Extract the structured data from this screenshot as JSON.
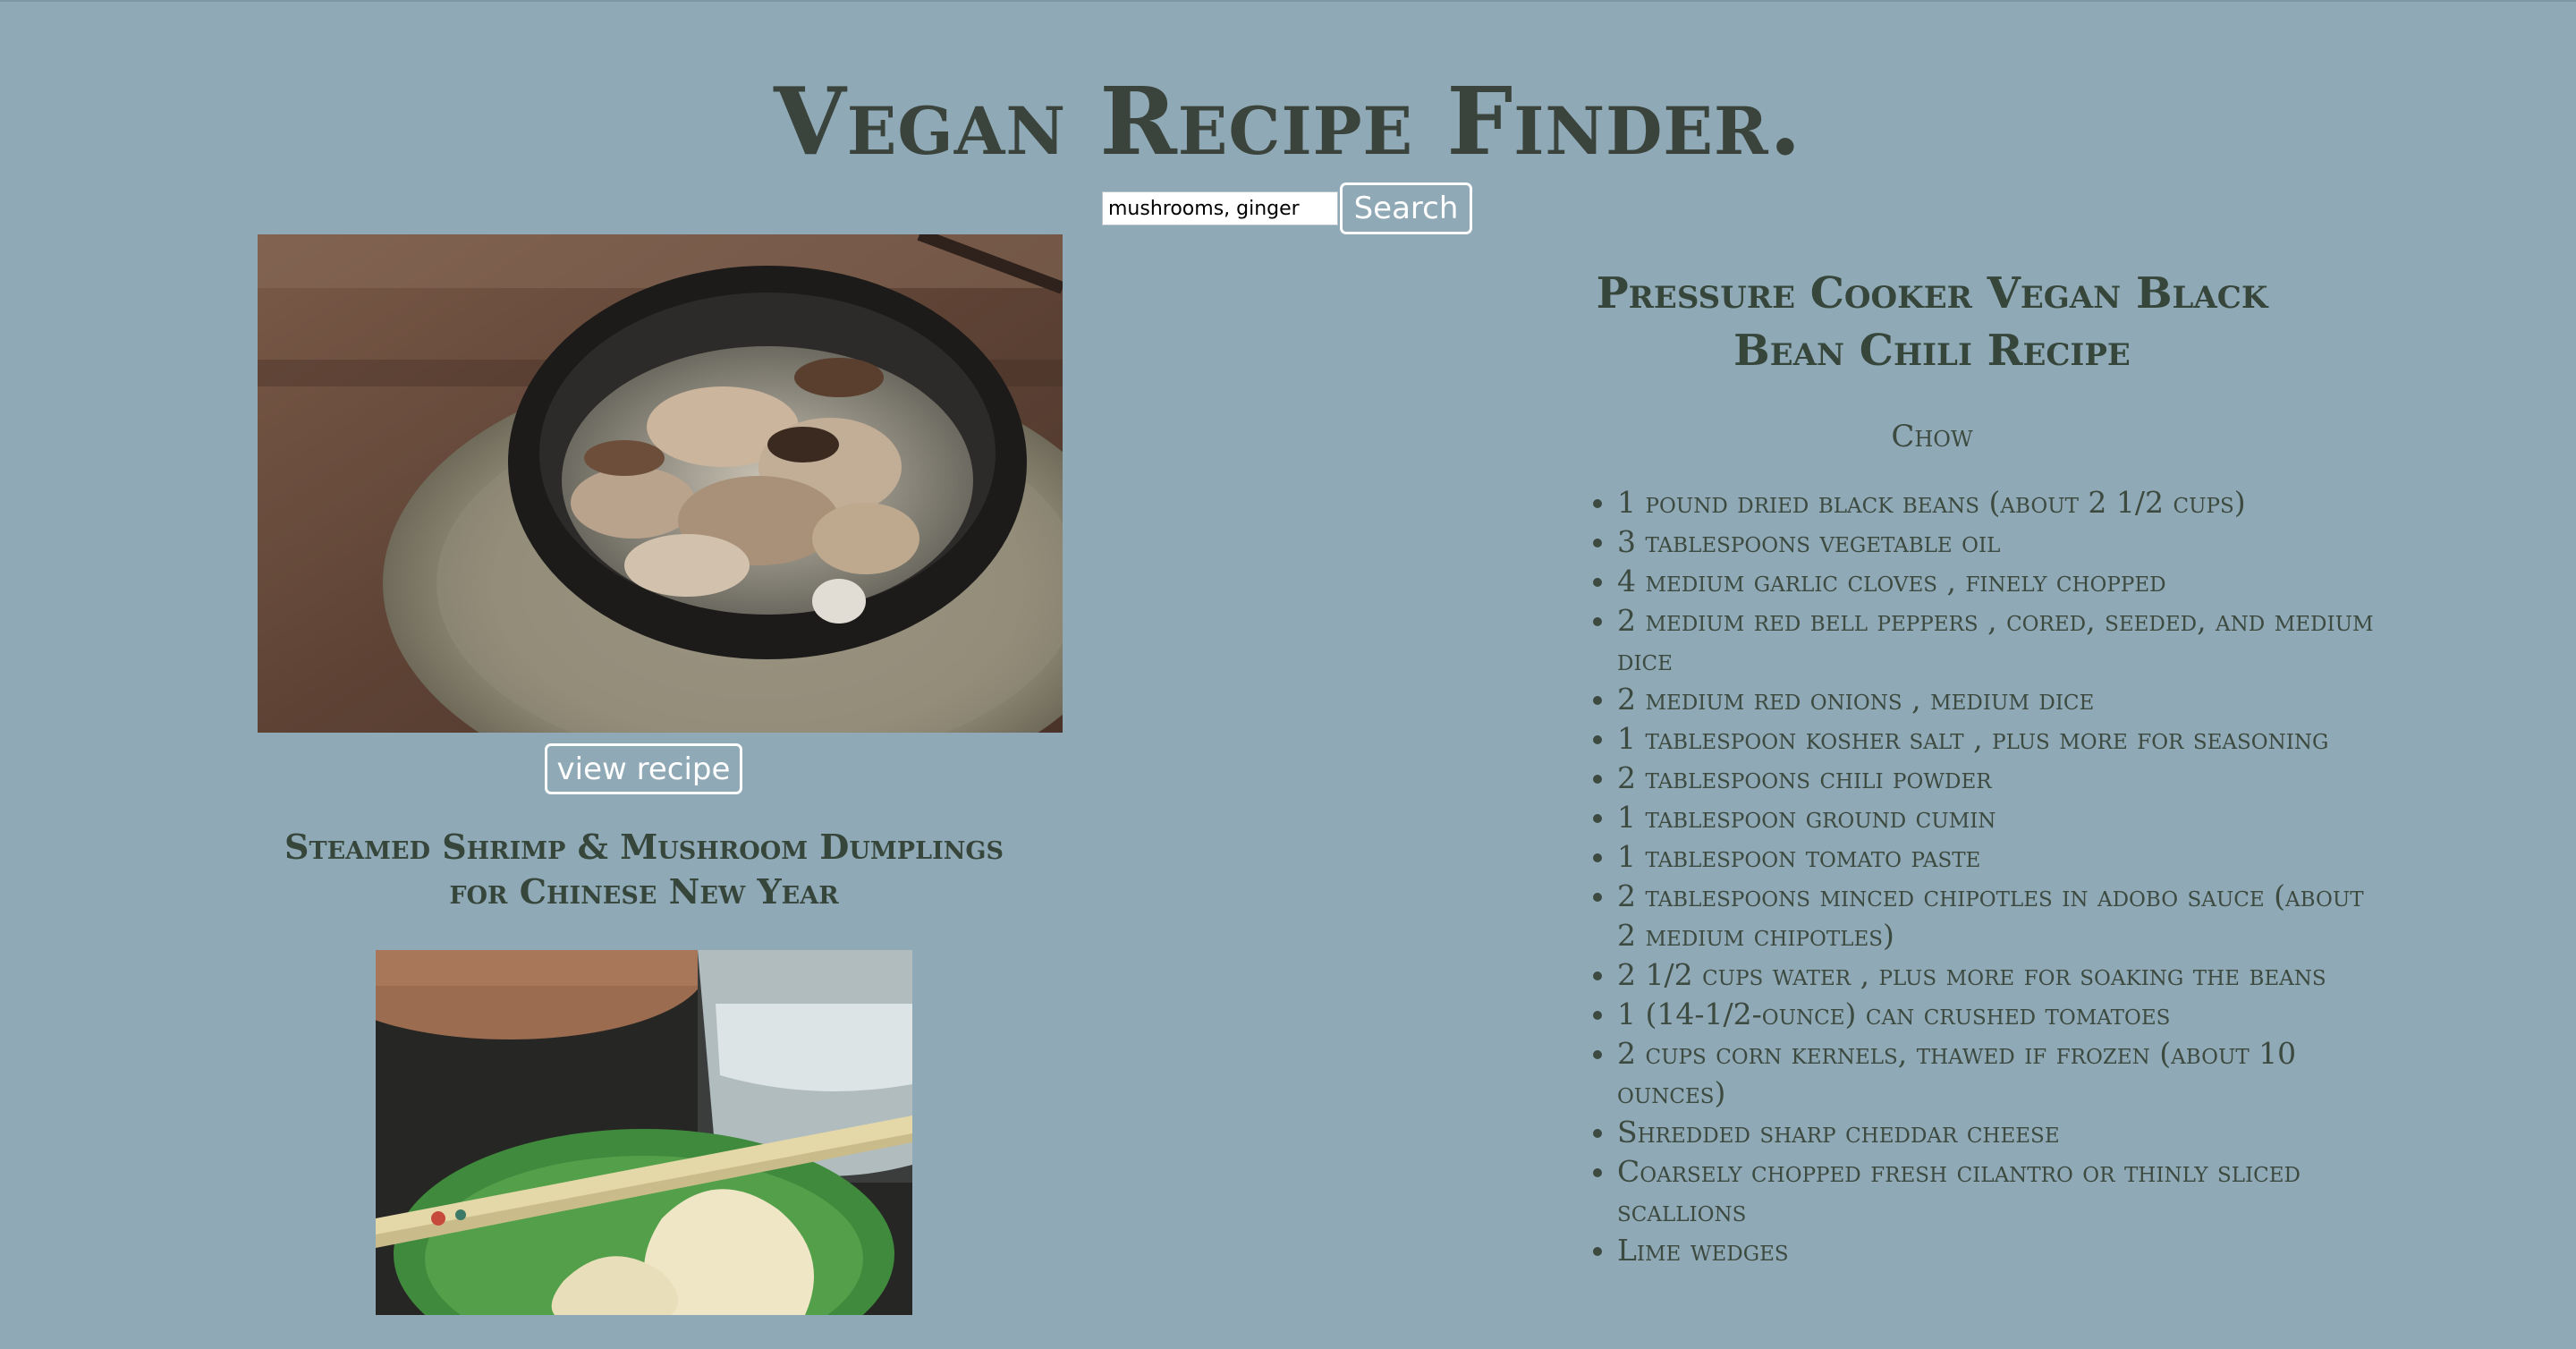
{
  "header": {
    "title": "Vegan Recipe Finder."
  },
  "search": {
    "value": "mushrooms, ginger",
    "button_label": "Search"
  },
  "results": [
    {
      "image": "mushroom-soup-bowl",
      "button_label": "view recipe"
    },
    {
      "title": "Steamed Shrimp & Mushroom Dumplings for Chinese New Year",
      "image": "dumplings-plate"
    }
  ],
  "detail": {
    "title": "Pressure Cooker Vegan Black Bean Chili Recipe",
    "source": "Chow",
    "ingredients": [
      "1 pound dried black beans (about 2 1/2 cups)",
      "3 tablespoons vegetable oil",
      "4 medium garlic cloves , finely chopped",
      "2 medium red bell peppers , cored, seeded, and medium dice",
      "2 medium red onions , medium dice",
      "1 tablespoon kosher salt , plus more for seasoning",
      "2 tablespoons chili powder",
      "1 tablespoon ground cumin",
      "1 tablespoon tomato paste",
      "2 tablespoons minced chipotles in adobo sauce (about 2 medium chipotles)",
      "2 1/2 cups water , plus more for soaking the beans",
      "1 (14-1/2-ounce) can crushed tomatoes",
      "2 cups corn kernels, thawed if frozen (about 10 ounces)",
      "Shredded sharp cheddar cheese",
      "Coarsely chopped fresh cilantro or thinly sliced scallions",
      "Lime wedges"
    ]
  },
  "colors": {
    "background": "#8fa9b6",
    "title_text": "#3b443c",
    "button_border": "#ffffff"
  }
}
